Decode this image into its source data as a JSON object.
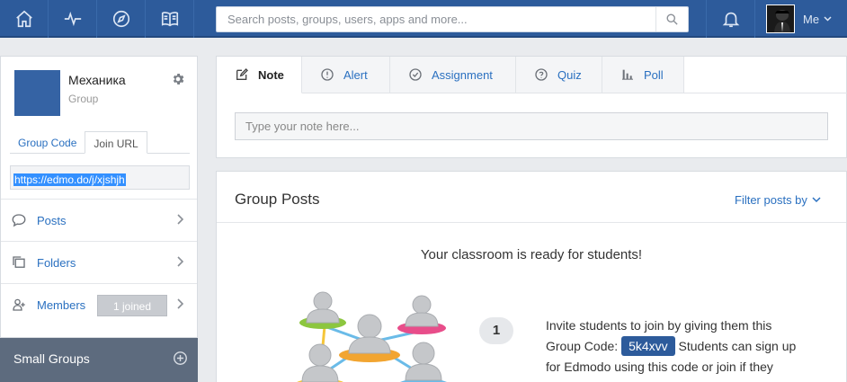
{
  "topbar": {
    "nav_icons": [
      "home-icon",
      "activity-icon",
      "compass-icon",
      "book-icon"
    ],
    "search_placeholder": "Search posts, groups, users, apps and more...",
    "me_label": "Me"
  },
  "sidebar": {
    "group_name": "Механика",
    "group_type": "Group",
    "code_tabs": [
      {
        "label": "Group Code"
      },
      {
        "label": "Join URL"
      }
    ],
    "join_url": "https://edmo.do/j/xjshjh",
    "items": [
      {
        "label": "Posts",
        "icon": "speech-bubble-icon"
      },
      {
        "label": "Folders",
        "icon": "folders-icon"
      },
      {
        "label": "Members",
        "icon": "members-icon",
        "badge": "1 joined"
      }
    ],
    "small_groups_label": "Small Groups"
  },
  "composer": {
    "tabs": [
      {
        "label": "Note",
        "icon": "note-edit-icon",
        "active": true
      },
      {
        "label": "Alert",
        "icon": "alert-icon"
      },
      {
        "label": "Assignment",
        "icon": "check-circle-icon"
      },
      {
        "label": "Quiz",
        "icon": "question-circle-icon"
      },
      {
        "label": "Poll",
        "icon": "bar-chart-icon"
      }
    ],
    "placeholder": "Type your note here..."
  },
  "posts": {
    "title": "Group Posts",
    "filter_label": "Filter posts by",
    "ready_text": "Your classroom is ready for students!",
    "step_number": "1",
    "invite_before": "Invite students to join by giving them this Group Code:",
    "group_code": "5k4xvv",
    "invite_after": "Students can sign up for Edmodo using this code or join if they have an existing account."
  },
  "colors": {
    "topbar": "#2d5b9b",
    "link": "#2a70c0",
    "small_groups_bg": "#5d6b7e"
  }
}
